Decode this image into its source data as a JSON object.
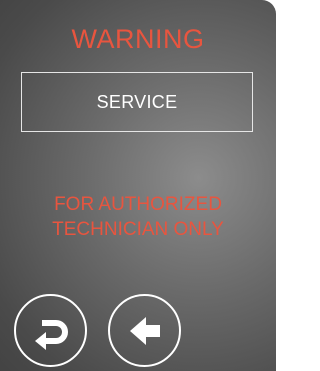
{
  "screen": {
    "title": "WARNING",
    "service_button": {
      "label": "SERVICE"
    },
    "message": {
      "line1": "FOR AUTHORIZED",
      "line2": "TECHNICIAN ONLY"
    },
    "buttons": {
      "return_icon": "return-icon",
      "back_icon": "arrow-left-icon"
    },
    "colors": {
      "warning_text": "#e8553f",
      "outline": "#ffffff",
      "background": "#5a5a5a"
    }
  }
}
